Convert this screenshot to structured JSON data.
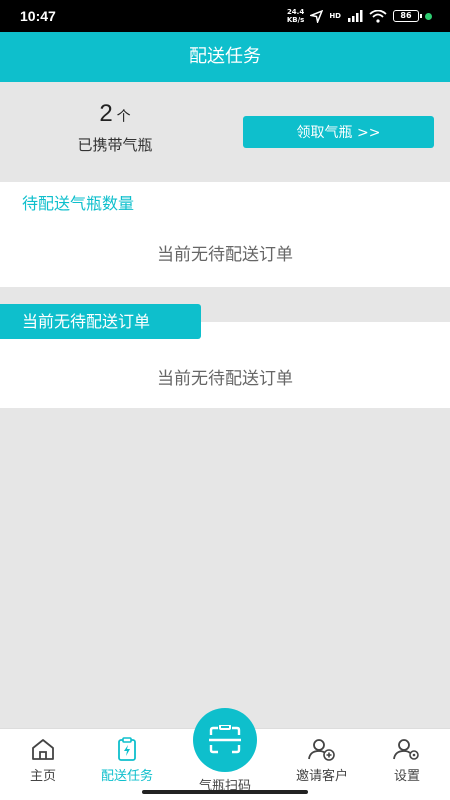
{
  "status": {
    "time": "10:47",
    "speed_value": "24.4",
    "speed_unit": "KB/s",
    "network": "HD",
    "battery": "86"
  },
  "header": {
    "title": "配送任务"
  },
  "summary": {
    "count": "2",
    "unit": "个",
    "label": "已携带气瓶",
    "claim_button": "领取气瓶 >>"
  },
  "section1": {
    "title": "待配送气瓶数量",
    "empty": "当前无待配送订单"
  },
  "section2": {
    "tag": "当前无待配送订单",
    "empty": "当前无待配送订单"
  },
  "tabs": {
    "home": "主页",
    "tasks": "配送任务",
    "scan": "气瓶扫码",
    "invite": "邀请客户",
    "settings": "设置"
  },
  "colors": {
    "accent": "#0ebfcc",
    "background": "#e6e6e6"
  }
}
